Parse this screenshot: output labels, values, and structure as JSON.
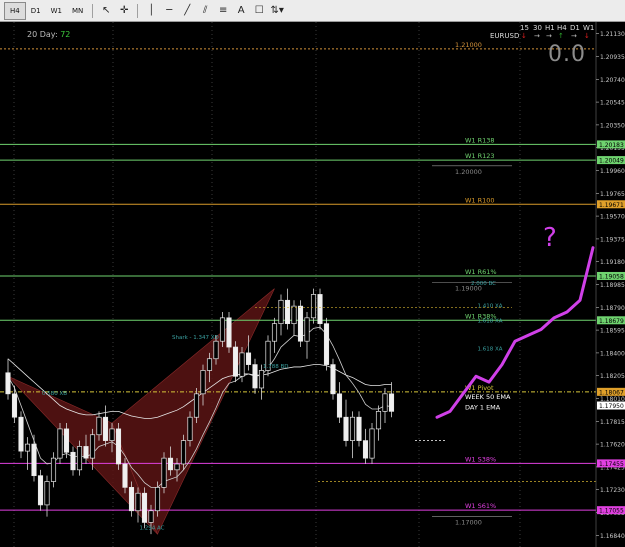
{
  "toolbar": {
    "timeframes": [
      "H4",
      "D1",
      "W1",
      "MN"
    ],
    "active_timeframe": "H4",
    "tools": [
      "cursor-tool",
      "crosshair-tool",
      "vertical-line-tool",
      "horizontal-line-tool",
      "trendline-tool",
      "channel-tool",
      "fibonacci-tool",
      "text-tool",
      "label-tool",
      "arrow-tool"
    ]
  },
  "overlay": {
    "twenty_day_label": "20 Day:",
    "twenty_day_value": "72",
    "symbol": "EURUSD",
    "tf_headers": [
      "15",
      "30",
      "H1",
      "H4",
      "D1",
      "W1"
    ],
    "tf_arrow_colors": [
      "#e02020",
      "#bbbbbb",
      "#bbbbbb",
      "#2ea82e",
      "#bbbbbb",
      "#e02020"
    ],
    "big_value": "0.0",
    "question_mark": "?"
  },
  "levels": [
    {
      "label": "1.21000",
      "price": 1.21,
      "color": "#d2923a",
      "style": "dotted",
      "label_side": "left"
    },
    {
      "label": "W1 R138",
      "price": 1.20183,
      "color": "#6fd36f",
      "style": "solid"
    },
    {
      "label": "W1 R123",
      "price": 1.20049,
      "color": "#6fd36f",
      "style": "solid"
    },
    {
      "label": "1.20000",
      "price": 1.2,
      "color": "#8a8a8a",
      "style": "thin"
    },
    {
      "label": "W1 R100",
      "price": 1.19671,
      "color": "#d89a2a",
      "style": "solid"
    },
    {
      "label": "W1 R61%",
      "price": 1.19058,
      "color": "#6fd36f",
      "style": "solid"
    },
    {
      "label": "1.19000",
      "price": 1.19,
      "color": "#8a8a8a",
      "style": "thin"
    },
    {
      "label": "W1 R38%",
      "price": 1.18679,
      "color": "#6fd36f",
      "style": "solid"
    },
    {
      "label": "W1 Pivot",
      "price": 1.18067,
      "color": "#d6c53a",
      "style": "dashdot"
    },
    {
      "label": "WEEK 50 EMA",
      "price": 1.1799,
      "color": "#ffffff",
      "style": "none"
    },
    {
      "label": "DAY 1 EMA",
      "price": 1.179,
      "color": "#ffffff",
      "style": "none"
    },
    {
      "label": "W1 S38%",
      "price": 1.17455,
      "color": "#e040e0",
      "style": "solid"
    },
    {
      "label": "W1 S61%",
      "price": 1.17055,
      "color": "#e040e0",
      "style": "solid"
    },
    {
      "label": "1.17000",
      "price": 1.17,
      "color": "#8a8a8a",
      "style": "thin"
    }
  ],
  "price_axis": {
    "ticks": [
      "1.21130",
      "1.20935",
      "1.20740",
      "1.20545",
      "1.20350",
      "1.20155",
      "1.19960",
      "1.19765",
      "1.19570",
      "1.19375",
      "1.19180",
      "1.18985",
      "1.18790",
      "1.18595",
      "1.18400",
      "1.18205",
      "1.18010",
      "1.17815",
      "1.17620",
      "1.17425",
      "1.17230",
      "1.17035",
      "1.16840"
    ],
    "badges": [
      {
        "text": "1.20183",
        "price": 1.20183,
        "bg": "#6fd36f"
      },
      {
        "text": "1.20049",
        "price": 1.20049,
        "bg": "#6fd36f"
      },
      {
        "text": "1.19671",
        "price": 1.19671,
        "bg": "#e0a02a"
      },
      {
        "text": "1.19058",
        "price": 1.19058,
        "bg": "#6fd36f"
      },
      {
        "text": "1.18679",
        "price": 1.18679,
        "bg": "#6fd36f"
      },
      {
        "text": "1.18067",
        "price": 1.18067,
        "bg": "#e0a02a"
      },
      {
        "text": "1.17950",
        "price": 1.1795,
        "bg": "#ffffff"
      },
      {
        "text": "1.17455",
        "price": 1.17455,
        "bg": "#e040e0"
      },
      {
        "text": "1.17055",
        "price": 1.17055,
        "bg": "#e040e0"
      }
    ]
  },
  "pattern_labels": [
    {
      "text": "Shark - 1.347 XD",
      "bar": 28,
      "price": 1.1852,
      "color": "#3aa0a0"
    },
    {
      "text": "1.788 BD",
      "bar": 42,
      "price": 1.1827,
      "color": "#3aa0a0"
    },
    {
      "text": "0.580 XB",
      "bar": 8,
      "price": 1.1804,
      "color": "#3aa0a0"
    },
    {
      "text": "1.294 AC",
      "bar": 23,
      "price": 1.1689,
      "color": "#3aa0a0"
    },
    {
      "text": "2.000 BC",
      "bar": 74,
      "price": 1.1898,
      "color": "#3aa0a0"
    },
    {
      "text": "1.410 XA",
      "bar": 75,
      "price": 1.1879,
      "color": "#3aa0a0"
    },
    {
      "text": "1.618 XA",
      "bar": 75,
      "price": 1.1866,
      "color": "#3aa0a0"
    },
    {
      "text": "1.618 XA",
      "bar": 75,
      "price": 1.1842,
      "color": "#3aa0a0"
    }
  ],
  "candles": [
    [
      1.1823,
      1.1835,
      1.18,
      1.1805
    ],
    [
      1.1805,
      1.1812,
      1.178,
      1.1785
    ],
    [
      1.1785,
      1.179,
      1.175,
      1.1756
    ],
    [
      1.1756,
      1.1768,
      1.174,
      1.1762
    ],
    [
      1.1762,
      1.177,
      1.173,
      1.1735
    ],
    [
      1.1735,
      1.174,
      1.1705,
      1.171
    ],
    [
      1.171,
      1.1735,
      1.17,
      1.173
    ],
    [
      1.173,
      1.1755,
      1.1725,
      1.175
    ],
    [
      1.175,
      1.178,
      1.1745,
      1.1775
    ],
    [
      1.1775,
      1.178,
      1.175,
      1.1755
    ],
    [
      1.1755,
      1.176,
      1.1735,
      1.174
    ],
    [
      1.174,
      1.1765,
      1.1735,
      1.176
    ],
    [
      1.176,
      1.177,
      1.1745,
      1.175
    ],
    [
      1.175,
      1.1775,
      1.174,
      1.177
    ],
    [
      1.177,
      1.179,
      1.1765,
      1.1785
    ],
    [
      1.1785,
      1.1795,
      1.176,
      1.1765
    ],
    [
      1.1765,
      1.178,
      1.1755,
      1.1775
    ],
    [
      1.1775,
      1.178,
      1.174,
      1.1745
    ],
    [
      1.1745,
      1.175,
      1.172,
      1.1725
    ],
    [
      1.1725,
      1.173,
      1.17,
      1.1705
    ],
    [
      1.1705,
      1.1725,
      1.1695,
      1.172
    ],
    [
      1.172,
      1.1725,
      1.169,
      1.1695
    ],
    [
      1.1695,
      1.171,
      1.1685,
      1.1705
    ],
    [
      1.1705,
      1.173,
      1.17,
      1.1725
    ],
    [
      1.1725,
      1.1755,
      1.172,
      1.175
    ],
    [
      1.175,
      1.176,
      1.1735,
      1.174
    ],
    [
      1.174,
      1.175,
      1.173,
      1.1745
    ],
    [
      1.1745,
      1.177,
      1.174,
      1.1765
    ],
    [
      1.1765,
      1.179,
      1.176,
      1.1785
    ],
    [
      1.1785,
      1.181,
      1.178,
      1.1805
    ],
    [
      1.1805,
      1.183,
      1.1795,
      1.1825
    ],
    [
      1.1825,
      1.184,
      1.1815,
      1.1835
    ],
    [
      1.1835,
      1.1855,
      1.183,
      1.185
    ],
    [
      1.185,
      1.1875,
      1.1845,
      1.187
    ],
    [
      1.187,
      1.1875,
      1.184,
      1.1845
    ],
    [
      1.1845,
      1.185,
      1.1815,
      1.182
    ],
    [
      1.182,
      1.1845,
      1.1815,
      1.184
    ],
    [
      1.184,
      1.1855,
      1.1825,
      1.183
    ],
    [
      1.183,
      1.1835,
      1.1805,
      1.181
    ],
    [
      1.181,
      1.183,
      1.18,
      1.1825
    ],
    [
      1.1825,
      1.1855,
      1.182,
      1.185
    ],
    [
      1.185,
      1.187,
      1.184,
      1.1865
    ],
    [
      1.1865,
      1.189,
      1.1855,
      1.1885
    ],
    [
      1.1885,
      1.1895,
      1.186,
      1.1865
    ],
    [
      1.1865,
      1.1885,
      1.1855,
      1.188
    ],
    [
      1.188,
      1.1885,
      1.1845,
      1.185
    ],
    [
      1.185,
      1.1875,
      1.1835,
      1.187
    ],
    [
      1.187,
      1.1895,
      1.1865,
      1.189
    ],
    [
      1.189,
      1.1895,
      1.186,
      1.1865
    ],
    [
      1.1865,
      1.187,
      1.1825,
      1.183
    ],
    [
      1.183,
      1.1835,
      1.18,
      1.1805
    ],
    [
      1.1805,
      1.1815,
      1.178,
      1.1785
    ],
    [
      1.1785,
      1.18,
      1.176,
      1.1765
    ],
    [
      1.1765,
      1.179,
      1.175,
      1.1785
    ],
    [
      1.1785,
      1.179,
      1.176,
      1.1765
    ],
    [
      1.1765,
      1.1775,
      1.1745,
      1.175
    ],
    [
      1.175,
      1.178,
      1.1745,
      1.1775
    ],
    [
      1.1775,
      1.1795,
      1.1765,
      1.179
    ],
    [
      1.179,
      1.181,
      1.178,
      1.1805
    ],
    [
      1.1805,
      1.1815,
      1.1785,
      1.179
    ]
  ],
  "ema_slow": [
    1.1835,
    1.183,
    1.1825,
    1.182,
    1.1815,
    1.181,
    1.1805,
    1.18,
    1.1795,
    1.1792,
    1.179,
    1.1788,
    1.1787,
    1.1787,
    1.1788,
    1.1789,
    1.179,
    1.179,
    1.1788,
    1.1786,
    1.1785,
    1.1784,
    1.1784,
    1.1785,
    1.1787,
    1.1789,
    1.1791,
    1.1794,
    1.1798,
    1.1802,
    1.1806,
    1.181,
    1.1814,
    1.1818,
    1.182,
    1.1821,
    1.1822,
    1.1822,
    1.1821,
    1.1821,
    1.1822,
    1.1824,
    1.1826,
    1.1827,
    1.1828,
    1.1828,
    1.1829,
    1.183,
    1.183,
    1.1829,
    1.1827,
    1.1824,
    1.1821,
    1.1819,
    1.1816,
    1.1813,
    1.1812,
    1.1812,
    1.1813,
    1.1813
  ],
  "ema_fast": [
    1.182,
    1.181,
    1.1795,
    1.178,
    1.1765,
    1.175,
    1.1745,
    1.1746,
    1.1752,
    1.1754,
    1.1751,
    1.1752,
    1.1751,
    1.1754,
    1.176,
    1.1762,
    1.1764,
    1.176,
    1.1752,
    1.1742,
    1.1736,
    1.1729,
    1.1725,
    1.1725,
    1.173,
    1.1732,
    1.1734,
    1.174,
    1.1748,
    1.1758,
    1.177,
    1.1781,
    1.1793,
    1.1806,
    1.1814,
    1.1816,
    1.182,
    1.1822,
    1.182,
    1.1821,
    1.1827,
    1.1835,
    1.1845,
    1.185,
    1.1855,
    1.1854,
    1.1856,
    1.1861,
    1.1862,
    1.1856,
    1.1846,
    1.1834,
    1.1821,
    1.1814,
    1.1806,
    1.1796,
    1.1792,
    1.1792,
    1.1795,
    1.1794
  ],
  "projection_path": [
    [
      0,
      1.1785
    ],
    [
      1,
      1.179
    ],
    [
      2,
      1.1805
    ],
    [
      3,
      1.182
    ],
    [
      4,
      1.1815
    ],
    [
      5,
      1.183
    ],
    [
      6,
      1.185
    ],
    [
      7,
      1.1855
    ],
    [
      8,
      1.186
    ],
    [
      9,
      1.187
    ],
    [
      10,
      1.1875
    ],
    [
      11,
      1.1885
    ],
    [
      12,
      1.193
    ]
  ]
}
